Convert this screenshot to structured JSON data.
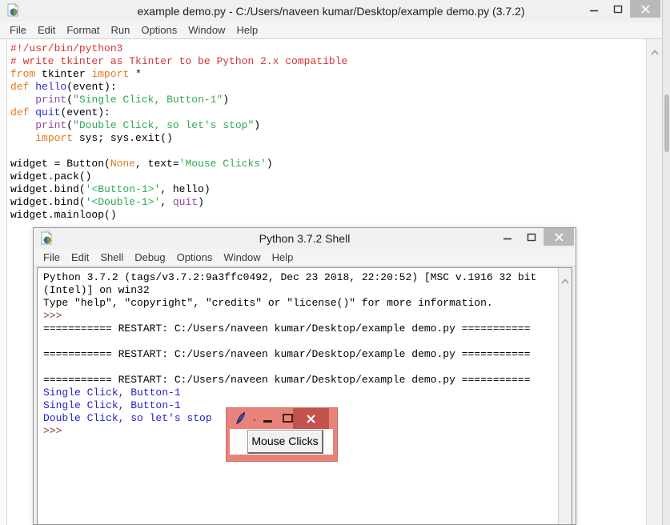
{
  "colors": {
    "syntax_comment": "#d13535",
    "syntax_keyword": "#e07a22",
    "syntax_definition": "#2a2ad4",
    "syntax_builtin": "#8e4a9e",
    "syntax_string": "#2eab4e",
    "shell_stdout_blue": "#2222c8",
    "shell_prompt_red": "#8f3431",
    "tk_titlebar_salmon": "#e8837b",
    "tk_close_button_red": "#c2524c"
  },
  "editor_window": {
    "title": "example demo.py - C:/Users/naveen kumar/Desktop/example demo.py (3.7.2)",
    "menu": [
      "File",
      "Edit",
      "Format",
      "Run",
      "Options",
      "Window",
      "Help"
    ],
    "code_lines": [
      [
        {
          "t": "#!/usr/bin/python3",
          "c": "comment"
        }
      ],
      [
        {
          "t": "# write tkinter as Tkinter to be Python 2.x compatible",
          "c": "comment"
        }
      ],
      [
        {
          "t": "from",
          "c": "keyword"
        },
        {
          "t": " tkinter ",
          "c": "plain"
        },
        {
          "t": "import",
          "c": "keyword"
        },
        {
          "t": " *",
          "c": "plain"
        }
      ],
      [
        {
          "t": "def",
          "c": "keyword"
        },
        {
          "t": " ",
          "c": "plain"
        },
        {
          "t": "hello",
          "c": "defname"
        },
        {
          "t": "(event):",
          "c": "plain"
        }
      ],
      [
        {
          "t": "    ",
          "c": "plain"
        },
        {
          "t": "print",
          "c": "builtin"
        },
        {
          "t": "(",
          "c": "plain"
        },
        {
          "t": "\"Single Click, Button-1\"",
          "c": "string"
        },
        {
          "t": ")",
          "c": "plain"
        }
      ],
      [
        {
          "t": "def",
          "c": "keyword"
        },
        {
          "t": " ",
          "c": "plain"
        },
        {
          "t": "quit",
          "c": "defname"
        },
        {
          "t": "(event):",
          "c": "plain"
        }
      ],
      [
        {
          "t": "    ",
          "c": "plain"
        },
        {
          "t": "print",
          "c": "builtin"
        },
        {
          "t": "(",
          "c": "plain"
        },
        {
          "t": "\"Double Click, so let's stop\"",
          "c": "string"
        },
        {
          "t": ")",
          "c": "plain"
        }
      ],
      [
        {
          "t": "    ",
          "c": "plain"
        },
        {
          "t": "import",
          "c": "keyword"
        },
        {
          "t": " sys; sys.exit()",
          "c": "plain"
        }
      ],
      [],
      [
        {
          "t": "widget = Button(",
          "c": "plain"
        },
        {
          "t": "None",
          "c": "keyword"
        },
        {
          "t": ", text=",
          "c": "plain"
        },
        {
          "t": "'Mouse Clicks'",
          "c": "string"
        },
        {
          "t": ")",
          "c": "plain"
        }
      ],
      [
        {
          "t": "widget.pack()",
          "c": "plain"
        }
      ],
      [
        {
          "t": "widget.bind(",
          "c": "plain"
        },
        {
          "t": "'<Button-1>'",
          "c": "string"
        },
        {
          "t": ", hello)",
          "c": "plain"
        }
      ],
      [
        {
          "t": "widget.bind(",
          "c": "plain"
        },
        {
          "t": "'<Double-1>'",
          "c": "string"
        },
        {
          "t": ", ",
          "c": "plain"
        },
        {
          "t": "quit",
          "c": "builtin"
        },
        {
          "t": ")",
          "c": "plain"
        }
      ],
      [
        {
          "t": "widget.mainloop()",
          "c": "plain"
        }
      ]
    ]
  },
  "shell_window": {
    "title": "Python 3.7.2 Shell",
    "menu": [
      "File",
      "Edit",
      "Shell",
      "Debug",
      "Options",
      "Window",
      "Help"
    ],
    "lines": [
      [
        {
          "t": "Python 3.7.2 (tags/v3.7.2:9a3ffc0492, Dec 23 2018, 22:20:52) [MSC v.1916 32 bit",
          "c": "plain"
        }
      ],
      [
        {
          "t": "(Intel)] on win32",
          "c": "plain"
        }
      ],
      [
        {
          "t": "Type \"help\", \"copyright\", \"credits\" or \"license()\" for more information.",
          "c": "plain"
        }
      ],
      [
        {
          "t": ">>> ",
          "c": "prompt"
        }
      ],
      [
        {
          "t": "=========== RESTART: C:/Users/naveen kumar/Desktop/example demo.py ===========",
          "c": "plain"
        }
      ],
      [],
      [
        {
          "t": "=========== RESTART: C:/Users/naveen kumar/Desktop/example demo.py ===========",
          "c": "plain"
        }
      ],
      [],
      [
        {
          "t": "=========== RESTART: C:/Users/naveen kumar/Desktop/example demo.py ===========",
          "c": "plain"
        }
      ],
      [
        {
          "t": "Single Click, Button-1",
          "c": "stdout"
        }
      ],
      [
        {
          "t": "Single Click, Button-1",
          "c": "stdout"
        }
      ],
      [
        {
          "t": "Double Click, so let's stop",
          "c": "stdout"
        }
      ],
      [
        {
          "t": ">>> ",
          "c": "prompt"
        }
      ]
    ]
  },
  "tk_window": {
    "button_label": "Mouse Clicks"
  }
}
